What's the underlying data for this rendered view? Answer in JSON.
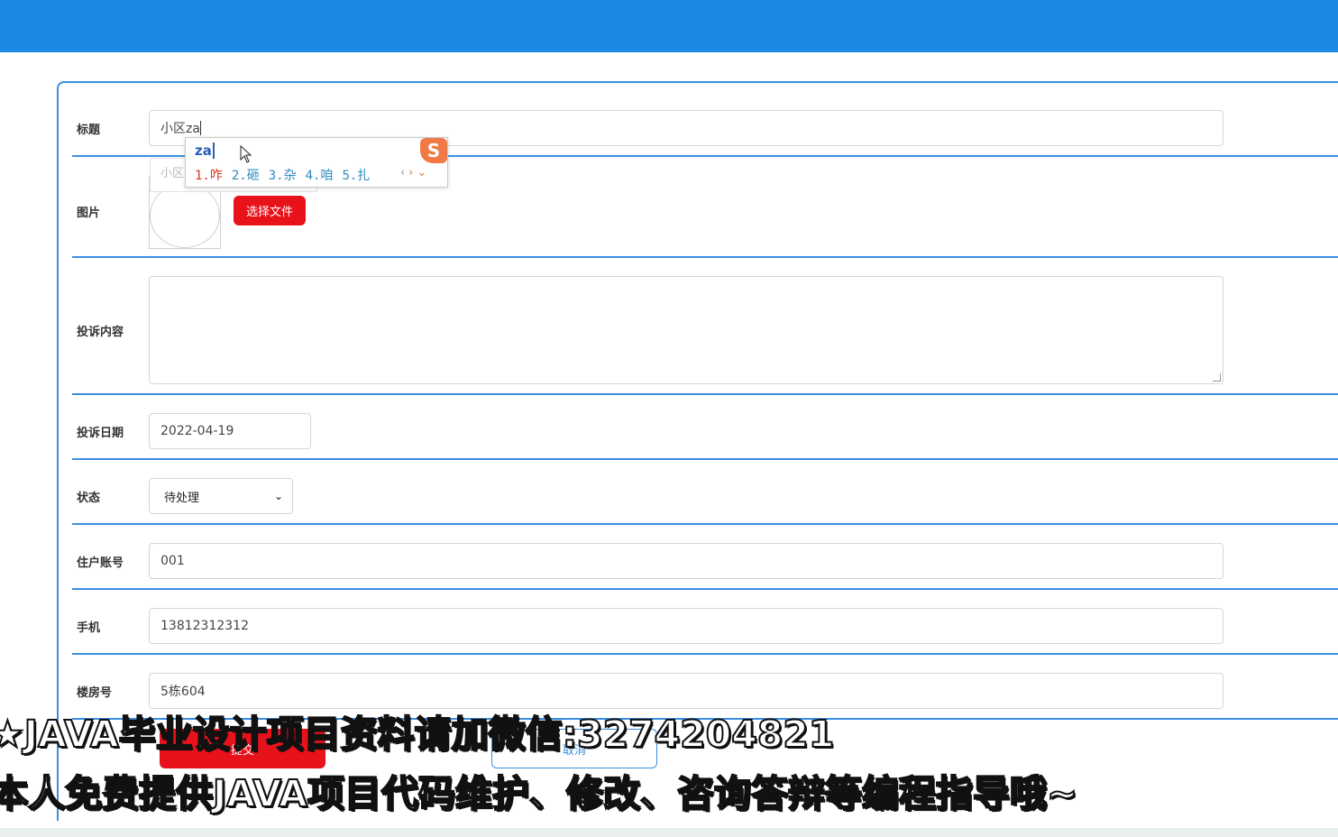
{
  "form": {
    "title": {
      "label": "标题",
      "value": "小区za"
    },
    "image": {
      "label": "图片",
      "choose_file_label": "选择文件"
    },
    "content": {
      "label": "投诉内容",
      "value": ""
    },
    "date": {
      "label": "投诉日期",
      "value": "2022-04-19"
    },
    "status": {
      "label": "状态",
      "selected": "待处理"
    },
    "account": {
      "label": "住户账号",
      "value": "001"
    },
    "phone": {
      "label": "手机",
      "value": "13812312312"
    },
    "building": {
      "label": "楼房号",
      "value": "5栋604"
    },
    "submit_label": "提交",
    "cancel_label": "取消"
  },
  "ime": {
    "typed": "za",
    "ghost_text": "小区",
    "logo": "S",
    "candidates": [
      "1.咋",
      "2.砸",
      "3.杂",
      "4.咱",
      "5.扎"
    ]
  },
  "overlay": {
    "line1": "★JAVA毕业设计项目资料请加微信:3274204821",
    "line2": "本人免费提供JAVA项目代码维护、修改、咨询答辩等编程指导哦~"
  },
  "colors": {
    "topbar": "#1e88e5",
    "accent": "#3a8ee0",
    "primary_button": "#e8121b"
  }
}
